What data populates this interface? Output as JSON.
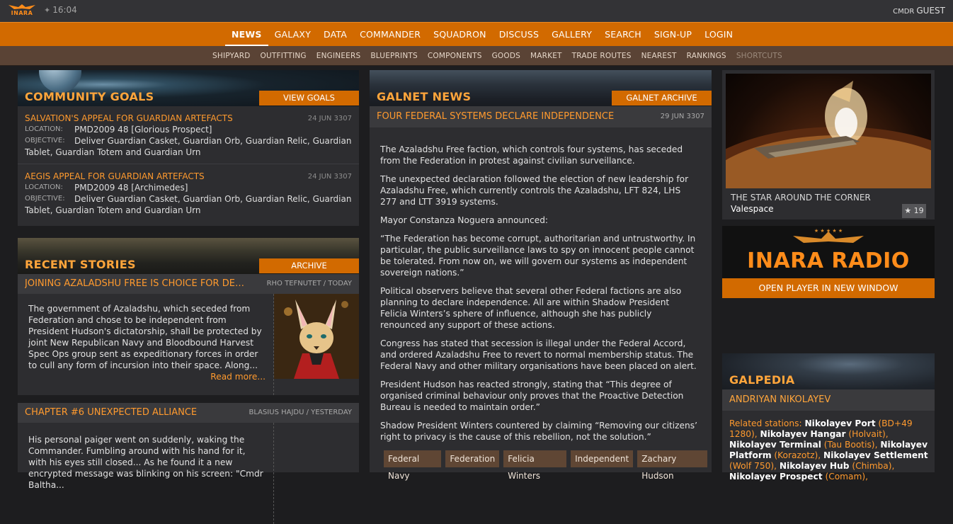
{
  "topbar": {
    "logo_text": "INARA",
    "time": "16:04",
    "cmdr_prefix": "CMDR",
    "cmdr_name": "GUEST"
  },
  "main_nav": [
    "NEWS",
    "GALAXY",
    "DATA",
    "COMMANDER",
    "SQUADRON",
    "DISCUSS",
    "GALLERY",
    "SEARCH",
    "SIGN-UP",
    "LOGIN"
  ],
  "sub_nav": [
    "SHIPYARD",
    "OUTFITTING",
    "ENGINEERS",
    "BLUEPRINTS",
    "COMPONENTS",
    "GOODS",
    "MARKET",
    "TRADE ROUTES",
    "NEAREST",
    "RANKINGS",
    "SHORTCUTS"
  ],
  "community_goals": {
    "title": "COMMUNITY GOALS",
    "button": "VIEW GOALS",
    "location_label": "LOCATION:",
    "objective_label": "OBJECTIVE:",
    "items": [
      {
        "title": "SALVATION'S APPEAL FOR GUARDIAN ARTEFACTS",
        "date": "24 JUN 3307",
        "location": "PMD2009 48 [Glorious Prospect]",
        "objective_first": "Deliver Guardian Casket, Guardian Orb, Guardian Relic, Guardian",
        "objective_rest": "Tablet, Guardian Totem and Guardian Urn"
      },
      {
        "title": "AEGIS APPEAL FOR GUARDIAN ARTEFACTS",
        "date": "24 JUN 3307",
        "location": "PMD2009 48 [Archimedes]",
        "objective_first": "Deliver Guardian Casket, Guardian Orb, Guardian Relic, Guardian",
        "objective_rest": "Tablet, Guardian Totem and Guardian Urn"
      }
    ]
  },
  "recent_stories": {
    "title": "RECENT STORIES",
    "button": "ARCHIVE",
    "items": [
      {
        "title": "JOINING AZALADSHU FREE IS CHOICE FOR DEM...",
        "meta": "RHO TEFNUTET / TODAY",
        "text": "The government of Azaladshu, which seceded from Federation and chose to be independent from President Hudson's dictatorship, shall be protected by joint New Republican Navy and Bloodbound Harvest Spec Ops group sent as expeditionary forces in order to cull any form of incursion into their space. Along...",
        "more": "Read more..."
      },
      {
        "title": "CHAPTER #6 UNEXPECTED ALLIANCE",
        "meta": "BLASIUS HAJDU / YESTERDAY",
        "text": "His personal paiger went on suddenly, waking the Commander. Fumbling around with his hand for it, with his eyes still closed... As he found it a new encrypted message was blinking on his screen: \"Cmdr Baltha..."
      }
    ]
  },
  "galnet": {
    "title": "GALNET NEWS",
    "button": "GALNET ARCHIVE",
    "article_title": "FOUR FEDERAL SYSTEMS DECLARE INDEPENDENCE",
    "article_date": "29 JUN 3307",
    "paragraphs": [
      "The Azaladshu Free faction, which controls four systems, has seceded from the Federation in protest against civilian surveillance.",
      "The unexpected declaration followed the election of new leadership for Azaladshu Free, which currently controls the Azaladshu, LFT 824, LHS 277 and LTT 3919 systems.",
      "Mayor Constanza Noguera announced:",
      "“The Federation has become corrupt, authoritarian and untrustworthy. In particular, the public surveillance laws to spy on innocent people cannot be tolerated. From now on, we will govern our systems as independent sovereign nations.”",
      "Political observers believe that several other Federal factions are also planning to declare independence. All are within Shadow President Felicia Winters’s sphere of influence, although she has publicly renounced any support of these actions.",
      "Congress has stated that secession is illegal under the Federal Accord, and ordered Azaladshu Free to revert to normal membership status. The Federal Navy and other military organisations have been placed on alert.",
      "President Hudson has reacted strongly, stating that “This degree of organised criminal behaviour only proves that the Proactive Detection Bureau is needed to maintain order.”",
      "Shadow President Winters countered by claiming “Removing our citizens’ right to privacy is the cause of this rebellion, not the solution.”"
    ],
    "tags": [
      "Federal Navy",
      "Federation",
      "Felicia Winters",
      "Independent",
      "Zachary Hudson"
    ]
  },
  "gallery_card": {
    "title": "THE STAR AROUND THE CORNER",
    "author": "Valespace",
    "likes": "★ 19"
  },
  "radio": {
    "title": "INARA RADIO",
    "button": "OPEN PLAYER IN NEW WINDOW"
  },
  "galpedia": {
    "title": "GALPEDIA",
    "name": "ANDRIYAN NIKOLAYEV",
    "related_label": "Related stations:",
    "stations": [
      {
        "name": "Nikolayev Port",
        "system": "(BD+49 1280)"
      },
      {
        "name": "Nikolayev Hangar",
        "system": "(Holvait)"
      },
      {
        "name": "Nikolayev Terminal",
        "system": "(Tau Bootis)"
      },
      {
        "name": "Nikolayev Platform",
        "system": "(Korazotz)"
      },
      {
        "name": "Nikolayev Settlement",
        "system": "(Wolf 750)"
      },
      {
        "name": "Nikolayev Hub",
        "system": "(Chimba)"
      },
      {
        "name": "Nikolayev Prospect",
        "system": "(Comam)"
      }
    ]
  },
  "colors": {
    "accent": "#d26a00",
    "accent_text": "#ff9a2e",
    "panel": "#2d2d30",
    "background": "#1d1d1f"
  }
}
